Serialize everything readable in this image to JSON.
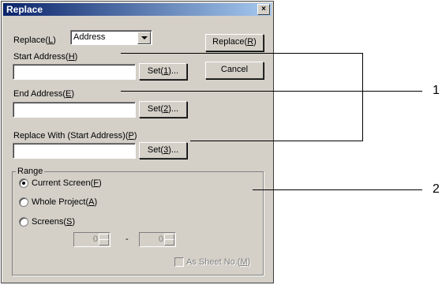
{
  "dialog": {
    "title": "Replace",
    "close_symbol": "×"
  },
  "replace": {
    "label": "Replace(L)",
    "selected_value": "Address"
  },
  "buttons": {
    "replace": "Replace(R)",
    "cancel": "Cancel",
    "set1": "Set(1)...",
    "set2": "Set(2)...",
    "set3": "Set(3)..."
  },
  "fields": {
    "start_address_label": "Start Address(H)",
    "start_address_value": "",
    "end_address_label": "End Address(E)",
    "end_address_value": "",
    "replace_with_label": "Replace With (Start Address)(P)",
    "replace_with_value": ""
  },
  "range": {
    "title": "Range",
    "options": [
      "Current Screen(F)",
      "Whole Project(A)",
      "Screens(S)"
    ],
    "selected_index": 0,
    "from_value": "0",
    "separator": "-",
    "to_value": "0",
    "as_sheet_no_label": "As Sheet No.(M)",
    "as_sheet_no_checked": false
  },
  "callouts": [
    "1",
    "2"
  ],
  "icons": {
    "close": "close-icon",
    "dropdown": "chevron-down-icon",
    "spin": "spinner-arrows-icon"
  },
  "colors": {
    "dialog_bg": "#d4d0c8",
    "title_start": "#0a246a",
    "title_end": "#a6caf0"
  }
}
